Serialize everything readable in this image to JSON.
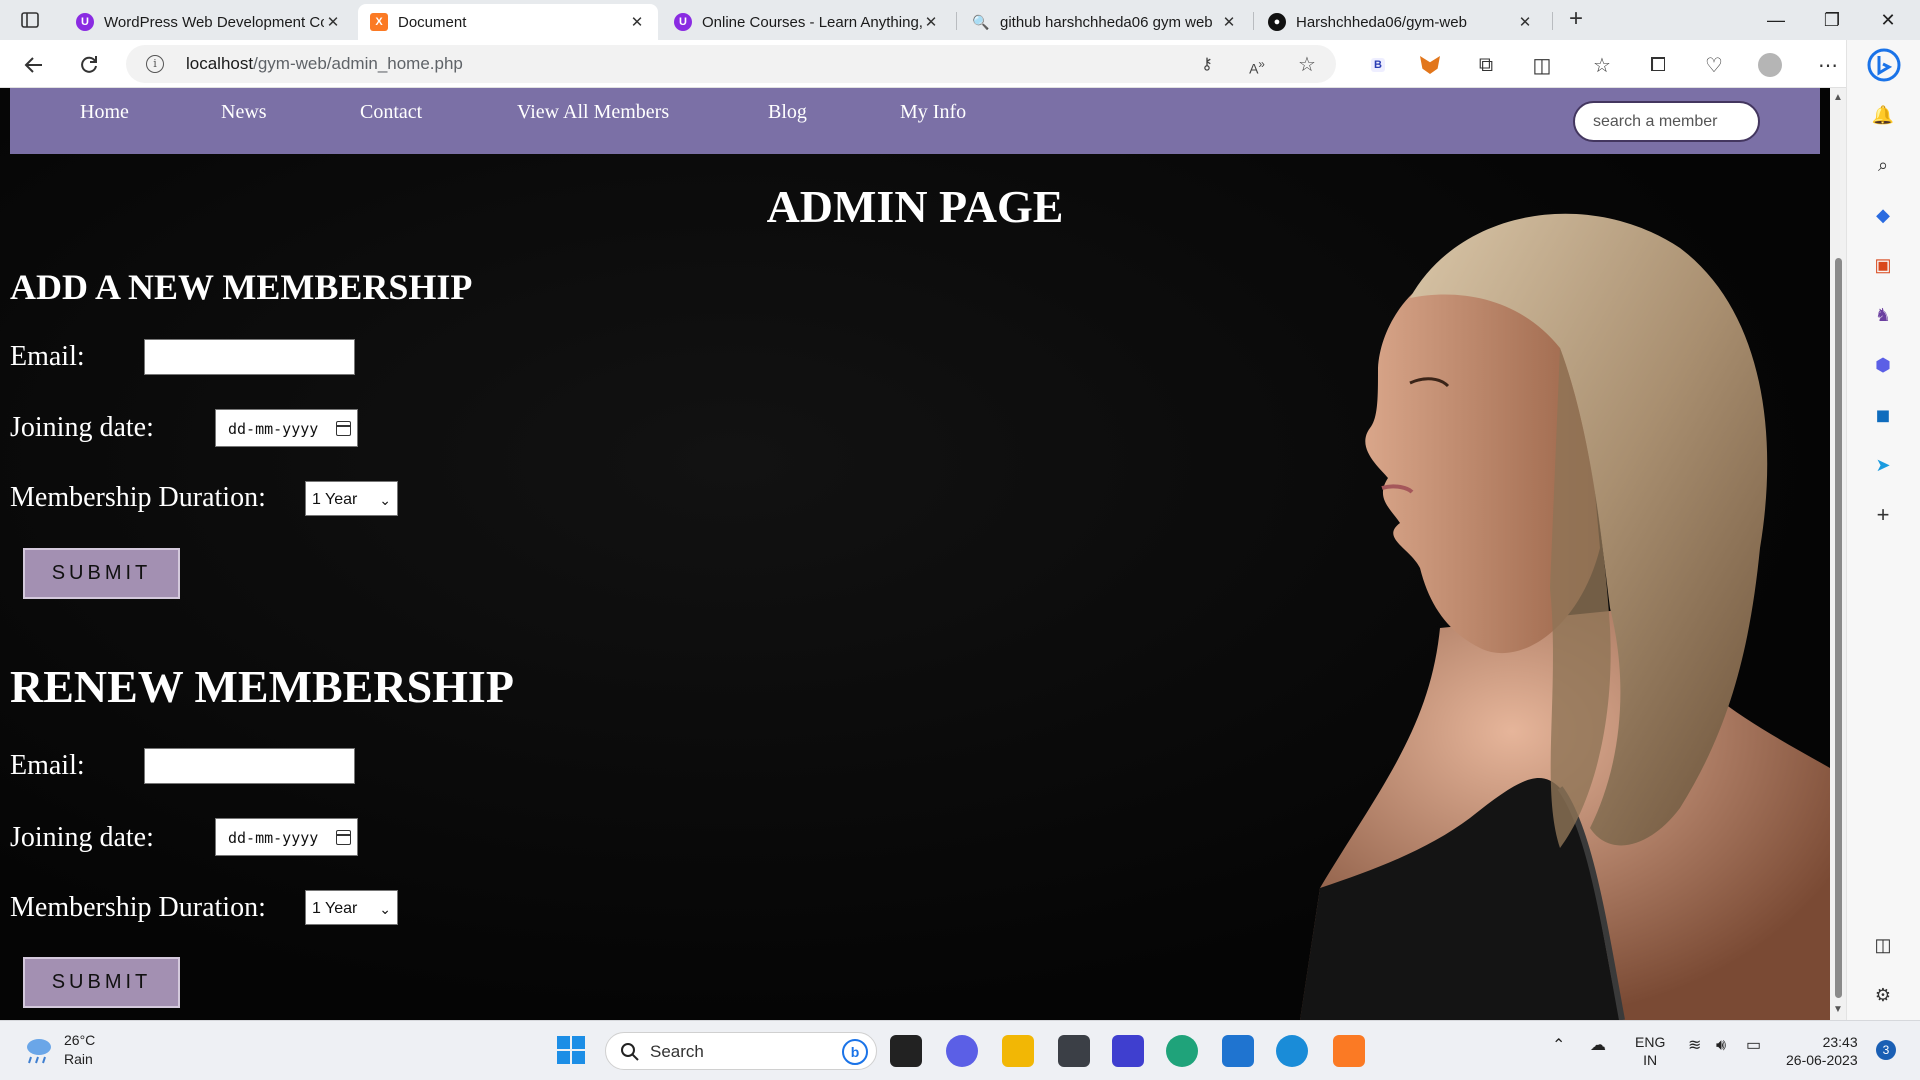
{
  "browser": {
    "tabs": [
      {
        "title": "WordPress Web Development Co",
        "favicon": "udemy-icon",
        "color": "#8a2be2",
        "active": false
      },
      {
        "title": "Document",
        "favicon": "xampp-icon",
        "color": "#fb7a24",
        "active": true
      },
      {
        "title": "Online Courses - Learn Anything,",
        "favicon": "udemy-icon",
        "color": "#8a2be2",
        "active": false
      },
      {
        "title": "github harshchheda06 gym web",
        "favicon": "search-icon",
        "color": "#1a73e8",
        "active": false
      },
      {
        "title": "Harshchheda06/gym-web",
        "favicon": "github-icon",
        "color": "#111111",
        "active": false
      }
    ],
    "url_host": "localhost",
    "url_path": "/gym-web/admin_home.php"
  },
  "nav": {
    "links": [
      "Home",
      "News",
      "Contact",
      "View All Members",
      "Blog",
      "My Info"
    ],
    "search_placeholder": "search a member"
  },
  "page": {
    "title": "ADMIN PAGE",
    "add_form": {
      "heading": "ADD A NEW MEMBERSHIP",
      "email_label": "Email:",
      "email_value": "",
      "date_label": "Joining date:",
      "date_placeholder": "dd-mm-yyyy",
      "duration_label": "Membership Duration:",
      "duration_value": "1 Year",
      "submit_label": "SUBMIT"
    },
    "renew_form": {
      "heading": "RENEW MEMBERSHIP",
      "email_label": "Email:",
      "email_value": "",
      "date_label": "Joining date:",
      "date_placeholder": "dd-mm-yyyy",
      "duration_label": "Membership Duration:",
      "duration_value": "1 Year",
      "submit_label": "SUBMIT"
    }
  },
  "taskbar": {
    "weather_temp": "26°C",
    "weather_desc": "Rain",
    "search_label": "Search",
    "lang_top": "ENG",
    "lang_bottom": "IN",
    "time": "23:43",
    "date": "26-06-2023",
    "notifications": "3"
  },
  "colors": {
    "nav_bg": "#7b70a6",
    "submit_bg": "#a390b2",
    "page_bg": "#000000"
  }
}
